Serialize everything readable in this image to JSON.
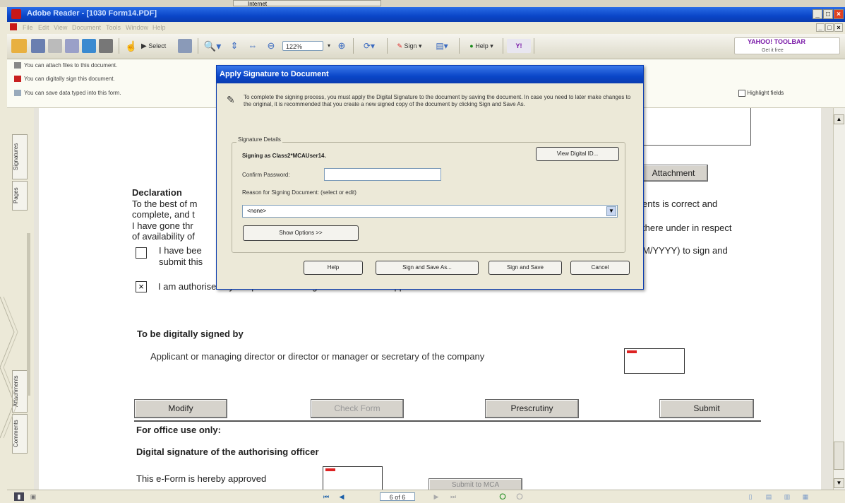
{
  "background_window": {
    "task_label": "Internet"
  },
  "window": {
    "title": "Adobe Reader - [1030 Form14.PDF]",
    "controls": [
      "_",
      "□",
      "×"
    ],
    "mdi_controls": [
      "_",
      "□",
      "×"
    ]
  },
  "menu": [
    "File",
    "Edit",
    "View",
    "Document",
    "Tools",
    "Window",
    "Help"
  ],
  "toolbar": {
    "select_label": "Select",
    "zoom_value": "122%",
    "sign_label": "Sign",
    "help_label": "Help",
    "yahoo_label": "YAHOO! TOOLBAR",
    "yahoo_sub": "Get it free"
  },
  "message_bar": {
    "lines": [
      "You can attach files to this document.",
      "You can digitally sign this document.",
      "You can save data typed into this form."
    ],
    "highlight_fields_label": "Highlight fields"
  },
  "left_tabs": [
    "Signatures",
    "Pages",
    "Attachments",
    "Comments"
  ],
  "form": {
    "attachment_button": "Attachment",
    "declaration_heading": "Declaration",
    "declaration_lines": [
      "To the best of m",
      "complete, and t",
      "I have gone thr",
      "of availability of"
    ],
    "declaration_right": [
      "ents is correct and",
      "there under in respect"
    ],
    "checkbox1_line1": "I have bee",
    "checkbox1_right": "M/YYYY) to sign and",
    "checkbox1_line2": "submit this",
    "checkbox2_label": "I am authorised by the promoters to sign and submit this application.",
    "checkbox2_mark": "×",
    "signed_by_heading": "To be digitally signed by",
    "signatory_text": "Applicant or managing director or director or manager or secretary of the company",
    "buttons": {
      "modify": "Modify",
      "check_form": "Check Form",
      "prescrutiny": "Prescrutiny",
      "submit": "Submit"
    },
    "office_use": "For office use only:",
    "officer_sig": "Digital signature of the authorising officer",
    "approved_text": "This e-Form is hereby approved",
    "submit_to_mca": "Submit to MCA"
  },
  "status": {
    "page_label": "6 of 6"
  },
  "dialog": {
    "title": "Apply Signature to Document",
    "instructions": "To complete the signing process, you must apply the Digital Signature to the document by saving the document. In case you need to later make changes to the original, it is recommended that you create a new signed copy of the document by clicking Sign and Save As.",
    "group_label": "Signature Details",
    "signing_as": "Signing as Class2*MCAUser14.",
    "view_id_button": "View Digital ID...",
    "confirm_password_label": "Confirm Password:",
    "confirm_password_value": "",
    "reason_label": "Reason for Signing Document: (select or edit)",
    "reason_value": "<none>",
    "show_options_button": "Show Options >>",
    "help_button": "Help",
    "sign_save_as_button": "Sign and Save As...",
    "sign_save_button": "Sign and Save",
    "cancel_button": "Cancel"
  },
  "colors": {
    "titlebar": "#0a46c8",
    "dialog_title": "#0a46c8",
    "sig_flag": "#dd2222"
  }
}
